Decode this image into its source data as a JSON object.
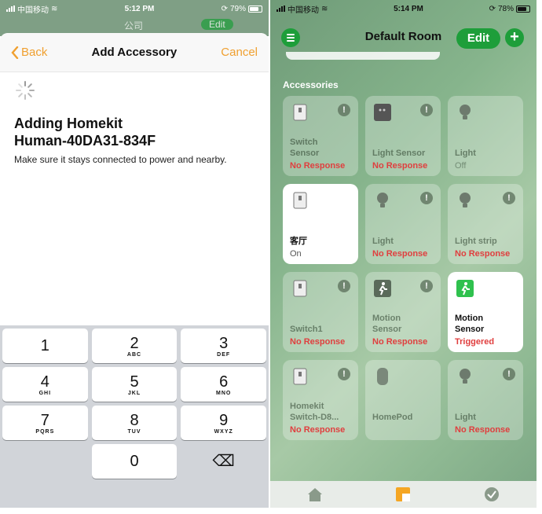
{
  "left_phone": {
    "status": {
      "carrier": "中国移动",
      "time": "5:12 PM",
      "battery": "79%"
    },
    "behind": {
      "title": "公司",
      "edit": "Edit"
    },
    "nav": {
      "back": "Back",
      "title": "Add Accessory",
      "cancel": "Cancel"
    },
    "adding_title_line1": "Adding Homekit",
    "adding_title_line2": "Human-40DA31-834F",
    "note": "Make sure it stays connected to power and nearby.",
    "keypad": [
      [
        {
          "n": "1",
          "l": ""
        },
        {
          "n": "2",
          "l": "ABC"
        },
        {
          "n": "3",
          "l": "DEF"
        }
      ],
      [
        {
          "n": "4",
          "l": "GHI"
        },
        {
          "n": "5",
          "l": "JKL"
        },
        {
          "n": "6",
          "l": "MNO"
        }
      ],
      [
        {
          "n": "7",
          "l": "PQRS"
        },
        {
          "n": "8",
          "l": "TUV"
        },
        {
          "n": "9",
          "l": "WXYZ"
        }
      ],
      [
        {
          "n": "",
          "l": ""
        },
        {
          "n": "0",
          "l": ""
        },
        {
          "n": "⌫",
          "l": ""
        }
      ]
    ]
  },
  "right_phone": {
    "status": {
      "carrier": "中国移动",
      "time": "5:14 PM",
      "battery": "78%"
    },
    "title": "Default Room",
    "edit": "Edit",
    "section": "Accessories",
    "tiles": [
      {
        "name": "Switch\nSensor",
        "status": "No Response",
        "icon": "switch-icon",
        "alert": true,
        "on": false
      },
      {
        "name": "Light Sensor",
        "status": "No Response",
        "icon": "light-sensor-icon",
        "alert": true,
        "on": false
      },
      {
        "name": "Light",
        "status": "Off",
        "icon": "bulb-icon",
        "alert": false,
        "on": false
      },
      {
        "name": "客厅",
        "status": "On",
        "icon": "switch-icon",
        "alert": false,
        "on": true
      },
      {
        "name": "Light",
        "status": "No Response",
        "icon": "bulb-icon",
        "alert": true,
        "on": false
      },
      {
        "name": "Light strip",
        "status": "No Response",
        "icon": "bulb-icon",
        "alert": true,
        "on": false
      },
      {
        "name": "Switch1",
        "status": "No Response",
        "icon": "switch-icon",
        "alert": true,
        "on": false
      },
      {
        "name": "Motion\nSensor",
        "status": "No Response",
        "icon": "motion-icon",
        "alert": true,
        "on": false
      },
      {
        "name": "Motion\nSensor",
        "status": "Triggered",
        "icon": "motion-icon",
        "alert": false,
        "on": true
      },
      {
        "name": "Homekit\nSwitch-D8...",
        "status": "No Response",
        "icon": "switch-icon",
        "alert": true,
        "on": false
      },
      {
        "name": "HomePod",
        "status": "",
        "icon": "homepod-icon",
        "alert": false,
        "on": false
      },
      {
        "name": "Light",
        "status": "No Response",
        "icon": "bulb-icon",
        "alert": true,
        "on": false
      }
    ],
    "tabs": [
      "home-tab-icon",
      "rooms-tab-icon",
      "automation-tab-icon"
    ],
    "colors": {
      "accent_green": "#1e9e3a",
      "orange": "#f0a030",
      "error_red": "#e03e3e"
    }
  }
}
